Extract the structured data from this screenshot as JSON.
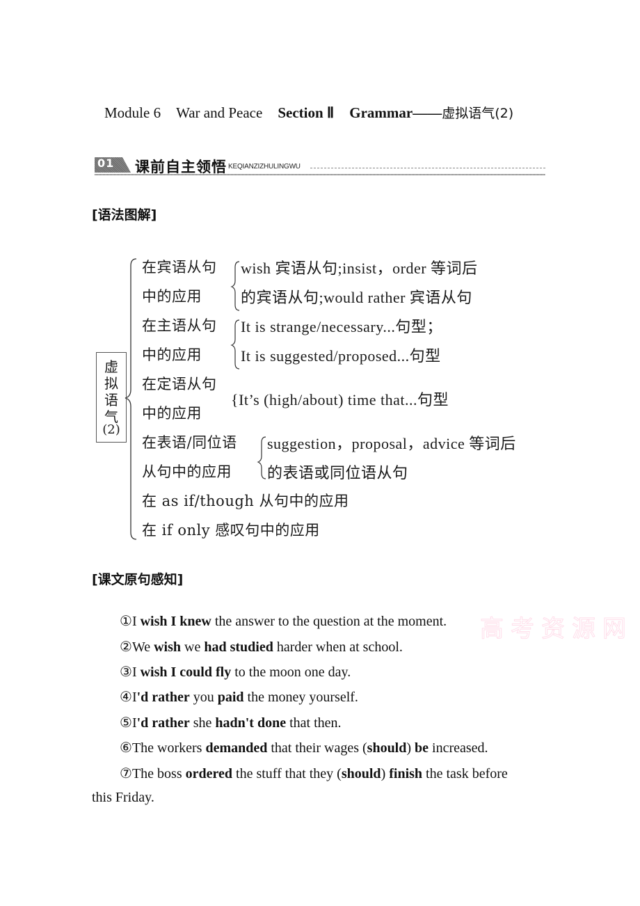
{
  "title": {
    "module": "Module 6",
    "topic": "War and Peace",
    "section": "Section Ⅱ",
    "grammar": "Grammar——",
    "subject": "虚拟语气(2)"
  },
  "banner": {
    "number": "01",
    "label_cn": "课前自主领悟",
    "label_pinyin": "KEQIANZIZHULINGWU"
  },
  "grammar_heading": "[语法图解]",
  "diagram": {
    "root": [
      "虚",
      "拟",
      "语",
      "气",
      "(2)"
    ],
    "branches": [
      {
        "label": [
          "在宾语从句",
          "中的应用"
        ],
        "details": [
          "wish 宾语从句;insist，order 等词后",
          "的宾语从句;would rather 宾语从句"
        ]
      },
      {
        "label": [
          "在主语从句",
          "中的应用"
        ],
        "details": [
          "It is strange/necessary...句型；",
          "It is suggested/proposed...句型"
        ]
      },
      {
        "label": [
          "在定语从句",
          "中的应用"
        ],
        "details": [
          "It’s (high/about) time that...句型"
        ]
      },
      {
        "label": [
          "在表语/同位语",
          "从句中的应用"
        ],
        "details": [
          "suggestion，proposal，advice 等词后",
          "的表语或同位语从句"
        ]
      },
      {
        "label": [
          "在 as if/though 从句中的应用"
        ]
      },
      {
        "label": [
          "在 if only 感叹句中的应用"
        ]
      }
    ]
  },
  "text_heading": "[课文原句感知]",
  "sentences": [
    {
      "num": "①",
      "parts": [
        [
          "I ",
          false
        ],
        [
          "wish I knew",
          true
        ],
        [
          " the answer to the question at the moment.",
          false
        ]
      ]
    },
    {
      "num": "②",
      "parts": [
        [
          "We ",
          false
        ],
        [
          "wish",
          true
        ],
        [
          " we ",
          false
        ],
        [
          "had studied",
          true
        ],
        [
          " harder when at school.",
          false
        ]
      ]
    },
    {
      "num": "③",
      "parts": [
        [
          "I ",
          false
        ],
        [
          "wish I could fly",
          true
        ],
        [
          " to the moon one day.",
          false
        ]
      ]
    },
    {
      "num": "④",
      "parts": [
        [
          "I",
          false
        ],
        [
          "'d rather",
          true
        ],
        [
          " you ",
          false
        ],
        [
          "paid",
          true
        ],
        [
          " the money yourself.",
          false
        ]
      ]
    },
    {
      "num": "⑤",
      "parts": [
        [
          "I",
          false
        ],
        [
          "'d rather",
          true
        ],
        [
          " she ",
          false
        ],
        [
          "hadn't done",
          true
        ],
        [
          " that then.",
          false
        ]
      ]
    },
    {
      "num": "⑥",
      "parts": [
        [
          "The workers ",
          false
        ],
        [
          "demanded",
          true
        ],
        [
          " that their wages (",
          false
        ],
        [
          "should",
          true
        ],
        [
          ") ",
          false
        ],
        [
          "be",
          true
        ],
        [
          " increased.",
          false
        ]
      ]
    },
    {
      "num": "⑦",
      "parts": [
        [
          "The boss ",
          false
        ],
        [
          "ordered",
          true
        ],
        [
          " the stuff that they (",
          false
        ],
        [
          "should",
          true
        ],
        [
          ") ",
          false
        ],
        [
          "finish",
          true
        ],
        [
          " the task before",
          false
        ]
      ]
    }
  ],
  "sentence_7_continuation": "this Friday.",
  "watermark": "高考资源网"
}
